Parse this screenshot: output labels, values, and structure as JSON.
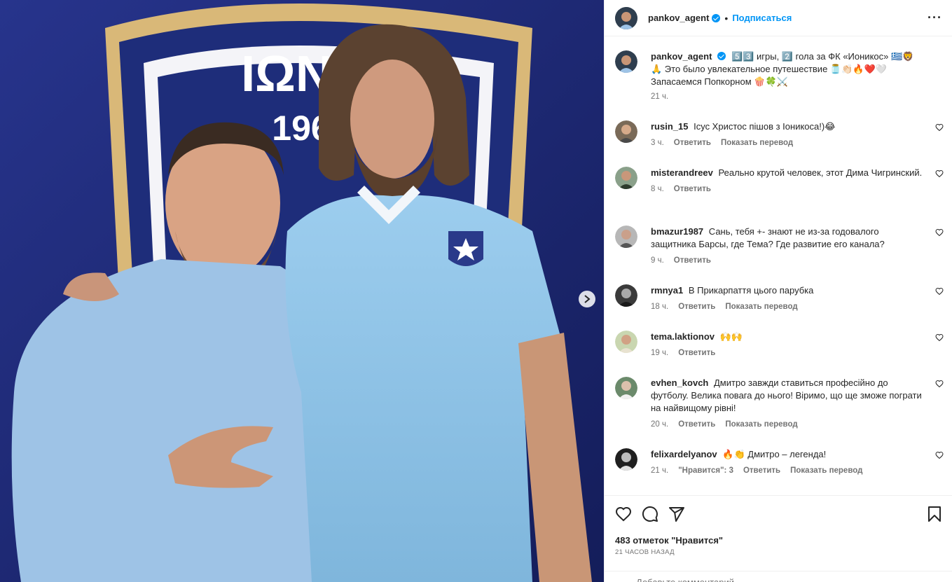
{
  "post": {
    "author": "pankov_agent",
    "follow_label": "Подписаться",
    "caption_text": "5️⃣3️⃣ игры, 2️⃣ гола за ФК «Ионикос» 🇬🇷🦁🙏 Это было увлекательное путешествие 🫙👏🏻🔥❤️🤍 Запасаемся Попкорном 🍿🍀⚔️",
    "caption_time": "21 ч.",
    "likes": "483 отметок \"Нравится\"",
    "time_ago": "21 ЧАСОВ НАЗАД",
    "add_comment_placeholder": "Добавьте комментарий..."
  },
  "comments": [
    {
      "user": "rusin_15",
      "text": "Ісус Христос пішов з Іоникоса!)😂",
      "time": "3 ч.",
      "likes": "",
      "reply": "Ответить",
      "translate": "Показать перевод"
    },
    {
      "user": "misterandreev",
      "text": "Реально крутой человек, этот Дима Чигринский.",
      "time": "8 ч.",
      "likes": "",
      "reply": "Ответить",
      "translate": ""
    },
    {
      "user": "bmazur1987",
      "text": "Сань, тебя +- знают не из-за годовалого защитника Барсы, где Тема? Где развитие его канала?",
      "time": "9 ч.",
      "likes": "",
      "reply": "Ответить",
      "translate": ""
    },
    {
      "user": "rmnya1",
      "text": "В Прикарпаття цього парубка",
      "time": "18 ч.",
      "likes": "",
      "reply": "Ответить",
      "translate": "Показать перевод"
    },
    {
      "user": "tema.laktionov",
      "text": "🙌🙌",
      "time": "19 ч.",
      "likes": "",
      "reply": "Ответить",
      "translate": ""
    },
    {
      "user": "evhen_kovch",
      "text": "Дмитро завжди ставиться професійно до футболу. Велика повага до нього! Віримо, що ще зможе пограти на найвищому рівні!",
      "time": "20 ч.",
      "likes": "",
      "reply": "Ответить",
      "translate": "Показать перевод"
    },
    {
      "user": "felixardelyanov",
      "text": "🔥👏 Дмитро – легенда!",
      "time": "21 ч.",
      "likes": "\"Нравится\": 3",
      "reply": "Ответить",
      "translate": "Показать перевод"
    }
  ],
  "photo": {
    "crest_text": "ΙΩΝΙΚ",
    "crest_year": "196"
  },
  "colors": {
    "accent": "#0095f6",
    "wall": "#1b2870",
    "jersey": "#8dc3e8",
    "tshirt": "#9ec3e6"
  },
  "icons": {
    "like": "heart-icon",
    "comment": "comment-icon",
    "share": "share-icon",
    "save": "bookmark-icon",
    "more": "more-icon",
    "next": "chevron-right-icon"
  }
}
